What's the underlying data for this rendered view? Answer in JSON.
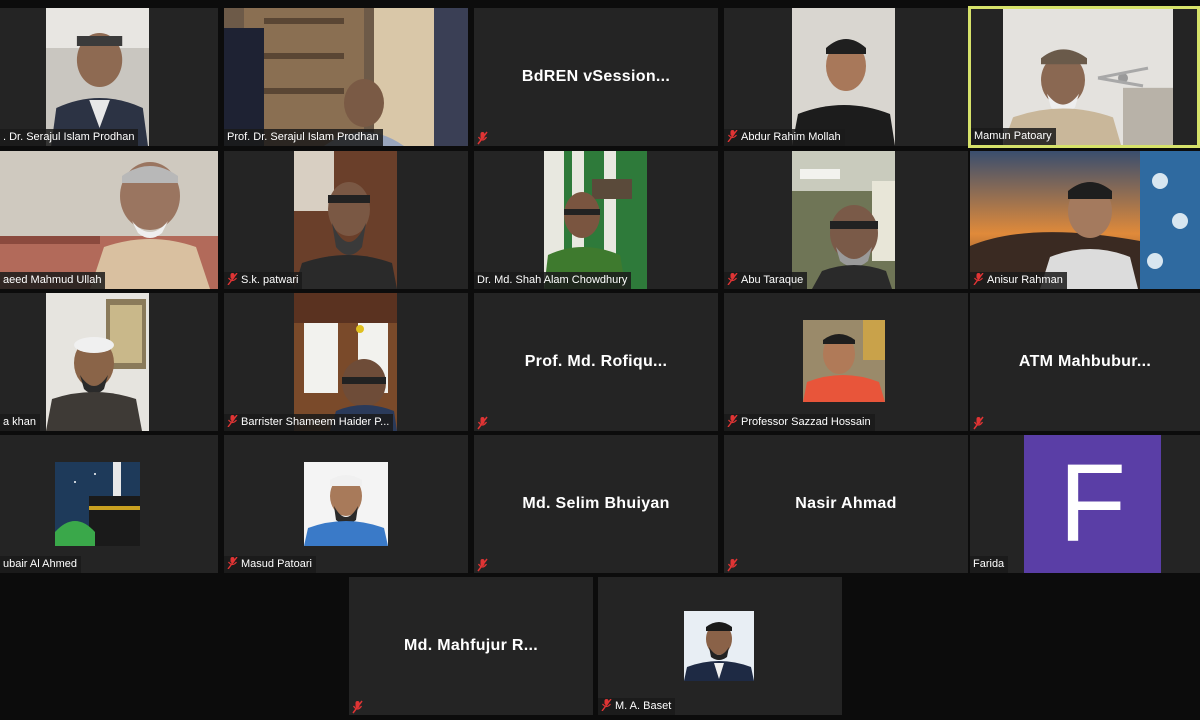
{
  "app": "Zoom gallery view",
  "colors": {
    "tile_bg": "#242424",
    "active_border": "#d6e26a",
    "muted_icon": "#e03434",
    "avatar_purple": "#5a3ea6"
  },
  "participants": [
    {
      "id": "p1",
      "label": ". Dr. Serajul Islam Prodhan",
      "muted": false
    },
    {
      "id": "p2",
      "label": "Prof. Dr. Serajul Islam Prodhan",
      "muted": false
    },
    {
      "id": "p3",
      "label": "",
      "display_name": "BdREN  vSession...",
      "muted": true
    },
    {
      "id": "p4",
      "label": "Abdur Rahim Mollah",
      "muted": true
    },
    {
      "id": "p5",
      "label": "Mamun Patoary",
      "muted": false,
      "active_speaker": true
    },
    {
      "id": "p6",
      "label": "aeed Mahmud Ullah",
      "muted": false
    },
    {
      "id": "p7",
      "label": "S.k. patwari",
      "muted": true
    },
    {
      "id": "p8",
      "label": "Dr. Md. Shah Alam Chowdhury",
      "muted": false
    },
    {
      "id": "p9",
      "label": "Abu Taraque",
      "muted": true
    },
    {
      "id": "p10",
      "label": "Anisur Rahman",
      "muted": true
    },
    {
      "id": "p11",
      "label": "a khan",
      "muted": false
    },
    {
      "id": "p12",
      "label": "Barrister Shameem Haider P...",
      "muted": true
    },
    {
      "id": "p13",
      "label": "",
      "display_name": "Prof. Md. Rofiqu...",
      "muted": true
    },
    {
      "id": "p14",
      "label": "Professor Sazzad Hossain",
      "muted": true
    },
    {
      "id": "p15",
      "label": "",
      "display_name": "ATM  Mahbubur...",
      "muted": true
    },
    {
      "id": "p16",
      "label": "ubair Al Ahmed",
      "muted": false
    },
    {
      "id": "p17",
      "label": "Masud Patoari",
      "muted": true
    },
    {
      "id": "p18",
      "label": "",
      "display_name": "Md. Selim Bhuiyan",
      "muted": true
    },
    {
      "id": "p19",
      "label": "",
      "display_name": "Nasir Ahmad",
      "muted": true
    },
    {
      "id": "p20",
      "label": "Farida",
      "muted": false,
      "avatar_letter": "F"
    },
    {
      "id": "p21",
      "label": "",
      "display_name": "Md.  Mahfujur  R...",
      "muted": true
    },
    {
      "id": "p22",
      "label": "M. A. Baset",
      "muted": true
    }
  ]
}
